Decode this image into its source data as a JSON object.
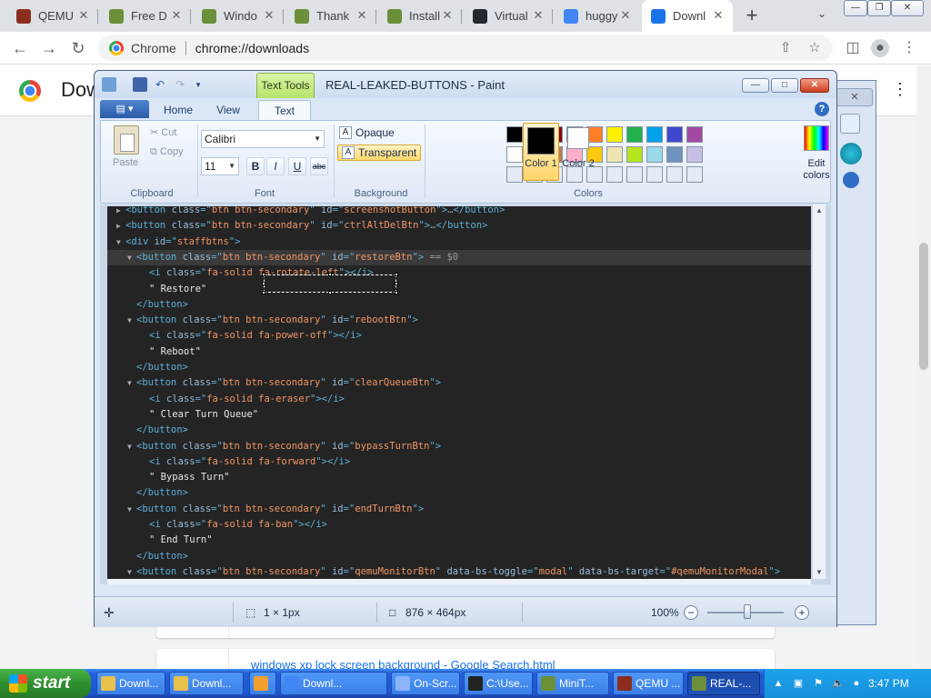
{
  "browser": {
    "tabs": [
      {
        "title": "QEMU",
        "icon_color": "#8b2e1e"
      },
      {
        "title": "Free D",
        "icon_color": "#6c8f3a"
      },
      {
        "title": "Windo",
        "icon_color": "#6c8f3a"
      },
      {
        "title": "Thank",
        "icon_color": "#6c8f3a"
      },
      {
        "title": "Install",
        "icon_color": "#6c8f3a"
      },
      {
        "title": "Virtual",
        "icon_color": "#24292f"
      },
      {
        "title": "huggy",
        "icon_color": "#4285f4"
      },
      {
        "title": "Downl",
        "icon_color": "#1a73e8"
      }
    ],
    "new_tab": "+",
    "tab_search": "⌄",
    "omnibox": {
      "site_chip": "Chrome",
      "url": "chrome://downloads"
    },
    "page_title": "Dow"
  },
  "downloads": {
    "partial_item": "windows xp lock screen background - Google Search.html"
  },
  "paint": {
    "contextual_tab": "Text Tools",
    "window_title": "REAL-LEAKED-BUTTONS - Paint",
    "ribbon_tabs": [
      "Home",
      "View",
      "Text"
    ],
    "clipboard": {
      "paste": "Paste",
      "cut": "Cut",
      "copy": "Copy",
      "label": "Clipboard"
    },
    "font": {
      "family": "Calibri",
      "size": "11",
      "bold": "B",
      "italic": "I",
      "underline": "U",
      "strike": "abc",
      "label": "Font"
    },
    "background": {
      "opaque": "Opaque",
      "transparent": "Transparent",
      "label": "Background"
    },
    "colors": {
      "color1": "Color 1",
      "color2": "Color 2",
      "edit": "Edit colors",
      "label": "Colors",
      "palette_row1": [
        "#000000",
        "#7f7f7f",
        "#880015",
        "#ed1c24",
        "#ff7f27",
        "#fff200",
        "#22b14c",
        "#00a2e8",
        "#3f48cc",
        "#a349a4"
      ],
      "palette_row2": [
        "#ffffff",
        "#c3c3c3",
        "#b97a57",
        "#ffaec9",
        "#ffc90e",
        "#efe4b0",
        "#b5e61d",
        "#99d9ea",
        "#7092be",
        "#c8bfe7"
      ]
    },
    "status": {
      "selection_size": "1 × 1px",
      "canvas_size": "876 × 464px",
      "zoom": "100%"
    }
  },
  "devtools_lines": [
    {
      "indent": 1,
      "tri": "▶",
      "parts": [
        [
          "tag",
          "<button "
        ],
        [
          "attr",
          "class"
        ],
        [
          "tag",
          "=\""
        ],
        [
          "val",
          "btn btn-secondary"
        ],
        [
          "tag",
          "\" "
        ],
        [
          "attr",
          "id"
        ],
        [
          "tag",
          "=\""
        ],
        [
          "val",
          "screenshotButton"
        ],
        [
          "tag",
          "\">"
        ],
        [
          "dim",
          "…"
        ],
        [
          "tag",
          "</button>"
        ]
      ]
    },
    {
      "indent": 1,
      "tri": "▶",
      "parts": [
        [
          "tag",
          "<button "
        ],
        [
          "attr",
          "class"
        ],
        [
          "tag",
          "=\""
        ],
        [
          "val",
          "btn btn-secondary"
        ],
        [
          "tag",
          "\" "
        ],
        [
          "attr",
          "id"
        ],
        [
          "tag",
          "=\""
        ],
        [
          "val",
          "ctrlAltDelBtn"
        ],
        [
          "tag",
          "\">"
        ],
        [
          "dim",
          "…"
        ],
        [
          "tag",
          "</button>"
        ]
      ]
    },
    {
      "indent": 1,
      "tri": "▼",
      "parts": [
        [
          "tag",
          "<div "
        ],
        [
          "attr",
          "id"
        ],
        [
          "tag",
          "=\""
        ],
        [
          "val",
          "staffbtns"
        ],
        [
          "tag",
          "\">"
        ]
      ]
    },
    {
      "indent": 2,
      "tri": "▼",
      "hl": true,
      "parts": [
        [
          "tag",
          "<button "
        ],
        [
          "attr",
          "class"
        ],
        [
          "tag",
          "=\""
        ],
        [
          "val",
          "btn btn-secondary"
        ],
        [
          "tag",
          "\" "
        ],
        [
          "attr",
          "id"
        ],
        [
          "tag",
          "=\""
        ],
        [
          "val",
          "restoreBtn"
        ],
        [
          "tag",
          "\">"
        ],
        [
          "dim",
          " == $0"
        ]
      ]
    },
    {
      "indent": 3,
      "tri": "",
      "parts": [
        [
          "tag",
          "<i "
        ],
        [
          "attr",
          "class"
        ],
        [
          "tag",
          "=\""
        ],
        [
          "val",
          "fa-solid fa-rotate-left"
        ],
        [
          "tag",
          "\"></i>"
        ]
      ]
    },
    {
      "indent": 3,
      "tri": "",
      "parts": [
        [
          "txt",
          "\" Restore\""
        ]
      ]
    },
    {
      "indent": 2,
      "tri": "",
      "parts": [
        [
          "tag",
          "</button>"
        ]
      ]
    },
    {
      "indent": 2,
      "tri": "▼",
      "parts": [
        [
          "tag",
          "<button "
        ],
        [
          "attr",
          "class"
        ],
        [
          "tag",
          "=\""
        ],
        [
          "val",
          "btn btn-secondary"
        ],
        [
          "tag",
          "\" "
        ],
        [
          "attr",
          "id"
        ],
        [
          "tag",
          "=\""
        ],
        [
          "val",
          "rebootBtn"
        ],
        [
          "tag",
          "\">"
        ]
      ]
    },
    {
      "indent": 3,
      "tri": "",
      "parts": [
        [
          "tag",
          "<i "
        ],
        [
          "attr",
          "class"
        ],
        [
          "tag",
          "=\""
        ],
        [
          "val",
          "fa-solid fa-power-off"
        ],
        [
          "tag",
          "\"></i>"
        ]
      ]
    },
    {
      "indent": 3,
      "tri": "",
      "parts": [
        [
          "txt",
          "\" Reboot\""
        ]
      ]
    },
    {
      "indent": 2,
      "tri": "",
      "parts": [
        [
          "tag",
          "</button>"
        ]
      ]
    },
    {
      "indent": 2,
      "tri": "▼",
      "parts": [
        [
          "tag",
          "<button "
        ],
        [
          "attr",
          "class"
        ],
        [
          "tag",
          "=\""
        ],
        [
          "val",
          "btn btn-secondary"
        ],
        [
          "tag",
          "\" "
        ],
        [
          "attr",
          "id"
        ],
        [
          "tag",
          "=\""
        ],
        [
          "val",
          "clearQueueBtn"
        ],
        [
          "tag",
          "\">"
        ]
      ]
    },
    {
      "indent": 3,
      "tri": "",
      "parts": [
        [
          "tag",
          "<i "
        ],
        [
          "attr",
          "class"
        ],
        [
          "tag",
          "=\""
        ],
        [
          "val",
          "fa-solid fa-eraser"
        ],
        [
          "tag",
          "\"></i>"
        ]
      ]
    },
    {
      "indent": 3,
      "tri": "",
      "parts": [
        [
          "txt",
          "\" Clear Turn Queue\""
        ]
      ]
    },
    {
      "indent": 2,
      "tri": "",
      "parts": [
        [
          "tag",
          "</button>"
        ]
      ]
    },
    {
      "indent": 2,
      "tri": "▼",
      "parts": [
        [
          "tag",
          "<button "
        ],
        [
          "attr",
          "class"
        ],
        [
          "tag",
          "=\""
        ],
        [
          "val",
          "btn btn-secondary"
        ],
        [
          "tag",
          "\" "
        ],
        [
          "attr",
          "id"
        ],
        [
          "tag",
          "=\""
        ],
        [
          "val",
          "bypassTurnBtn"
        ],
        [
          "tag",
          "\">"
        ]
      ]
    },
    {
      "indent": 3,
      "tri": "",
      "parts": [
        [
          "tag",
          "<i "
        ],
        [
          "attr",
          "class"
        ],
        [
          "tag",
          "=\""
        ],
        [
          "val",
          "fa-solid fa-forward"
        ],
        [
          "tag",
          "\"></i>"
        ]
      ]
    },
    {
      "indent": 3,
      "tri": "",
      "parts": [
        [
          "txt",
          "\" Bypass Turn\""
        ]
      ]
    },
    {
      "indent": 2,
      "tri": "",
      "parts": [
        [
          "tag",
          "</button>"
        ]
      ]
    },
    {
      "indent": 2,
      "tri": "▼",
      "parts": [
        [
          "tag",
          "<button "
        ],
        [
          "attr",
          "class"
        ],
        [
          "tag",
          "=\""
        ],
        [
          "val",
          "btn btn-secondary"
        ],
        [
          "tag",
          "\" "
        ],
        [
          "attr",
          "id"
        ],
        [
          "tag",
          "=\""
        ],
        [
          "val",
          "endTurnBtn"
        ],
        [
          "tag",
          "\">"
        ]
      ]
    },
    {
      "indent": 3,
      "tri": "",
      "parts": [
        [
          "tag",
          "<i "
        ],
        [
          "attr",
          "class"
        ],
        [
          "tag",
          "=\""
        ],
        [
          "val",
          "fa-solid fa-ban"
        ],
        [
          "tag",
          "\"></i>"
        ]
      ]
    },
    {
      "indent": 3,
      "tri": "",
      "parts": [
        [
          "txt",
          "\" End Turn\""
        ]
      ]
    },
    {
      "indent": 2,
      "tri": "",
      "parts": [
        [
          "tag",
          "</button>"
        ]
      ]
    },
    {
      "indent": 2,
      "tri": "▼",
      "parts": [
        [
          "tag",
          "<button "
        ],
        [
          "attr",
          "class"
        ],
        [
          "tag",
          "=\""
        ],
        [
          "val",
          "btn btn-secondary"
        ],
        [
          "tag",
          "\" "
        ],
        [
          "attr",
          "id"
        ],
        [
          "tag",
          "=\""
        ],
        [
          "val",
          "qemuMonitorBtn"
        ],
        [
          "tag",
          "\" "
        ],
        [
          "attr",
          "data-bs-toggle"
        ],
        [
          "tag",
          "=\""
        ],
        [
          "val",
          "modal"
        ],
        [
          "tag",
          "\" "
        ],
        [
          "attr",
          "data-bs-target"
        ],
        [
          "tag",
          "=\""
        ],
        [
          "val",
          "#qemuMonitorModal"
        ],
        [
          "tag",
          "\">"
        ]
      ]
    }
  ],
  "taskbar": {
    "start": "start",
    "items": [
      {
        "label": "Downl...",
        "icon_color": "#e8c14a",
        "active": false
      },
      {
        "label": "Downl...",
        "icon_color": "#e8c14a",
        "active": false
      },
      {
        "label": "",
        "icon_color": "#f0a030",
        "active": false
      },
      {
        "label": "Downl...",
        "icon_color": "#4285f4",
        "active": false
      },
      {
        "label": "On-Scr...",
        "icon_color": "#8ab4f8",
        "active": false
      },
      {
        "label": "C:\\Use...",
        "icon_color": "#222222",
        "active": false
      },
      {
        "label": "MiniT...",
        "icon_color": "#6c8f3a",
        "active": false
      },
      {
        "label": "QEMU ...",
        "icon_color": "#8b2e1e",
        "active": false
      },
      {
        "label": "REAL-...",
        "icon_color": "#6c8f3a",
        "active": true
      }
    ],
    "clock": "3:47 PM"
  }
}
